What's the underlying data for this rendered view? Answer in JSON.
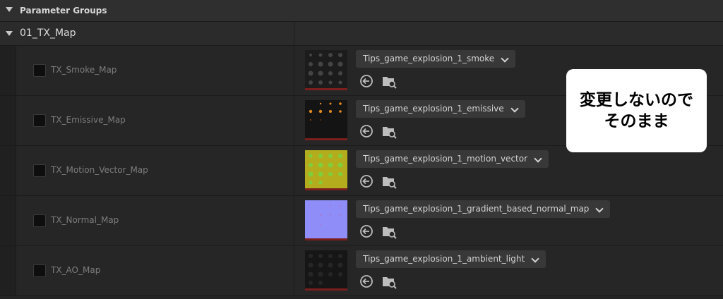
{
  "header": {
    "title": "Parameter Groups"
  },
  "group": {
    "title": "01_TX_Map"
  },
  "params": [
    {
      "name": "TX_Smoke_Map",
      "texture": "Tips_game_explosion_1_smoke"
    },
    {
      "name": "TX_Emissive_Map",
      "texture": "Tips_game_explosion_1_emissive"
    },
    {
      "name": "TX_Motion_Vector_Map",
      "texture": "Tips_game_explosion_1_motion_vector"
    },
    {
      "name": "TX_Normal_Map",
      "texture": "Tips_game_explosion_1_gradient_based_normal_map"
    },
    {
      "name": "TX_AO_Map",
      "texture": "Tips_game_explosion_1_ambient_light"
    }
  ],
  "callout": {
    "line1": "変更しないので",
    "line2": "そのまま"
  },
  "icons": {
    "use_selected": "arrow-left-circle-icon",
    "browse": "folder-search-icon",
    "expand": "caret-down-icon",
    "dropdown": "chevron-down-icon"
  },
  "colors": {
    "smoke_thumb": "#1c1c1c",
    "emissive_thumb": "#141414",
    "motion_vector_thumb": "#b3ad1e",
    "normal_thumb": "#8f8ef8",
    "ao_thumb": "#161616"
  }
}
